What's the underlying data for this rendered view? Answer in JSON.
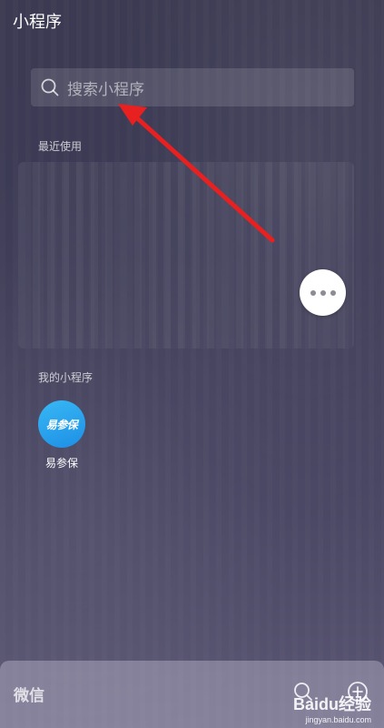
{
  "header": {
    "title": "小程序"
  },
  "search": {
    "placeholder": "搜索小程序",
    "icon": "search-icon"
  },
  "sections": {
    "recent": {
      "label": "最近使用"
    },
    "mine": {
      "label": "我的小程序"
    }
  },
  "apps": [
    {
      "name": "易参保",
      "icon_text": "易参保",
      "icon_color": "#2aa6f0"
    }
  ],
  "more_button": {
    "icon": "more-dots-icon"
  },
  "bottom_bar": {
    "title": "微信"
  },
  "watermark": {
    "brand": "Baidu经验",
    "url": "jingyan.baidu.com"
  },
  "colors": {
    "annotation_arrow": "#e82020",
    "app_icon": "#2aa6f0"
  }
}
